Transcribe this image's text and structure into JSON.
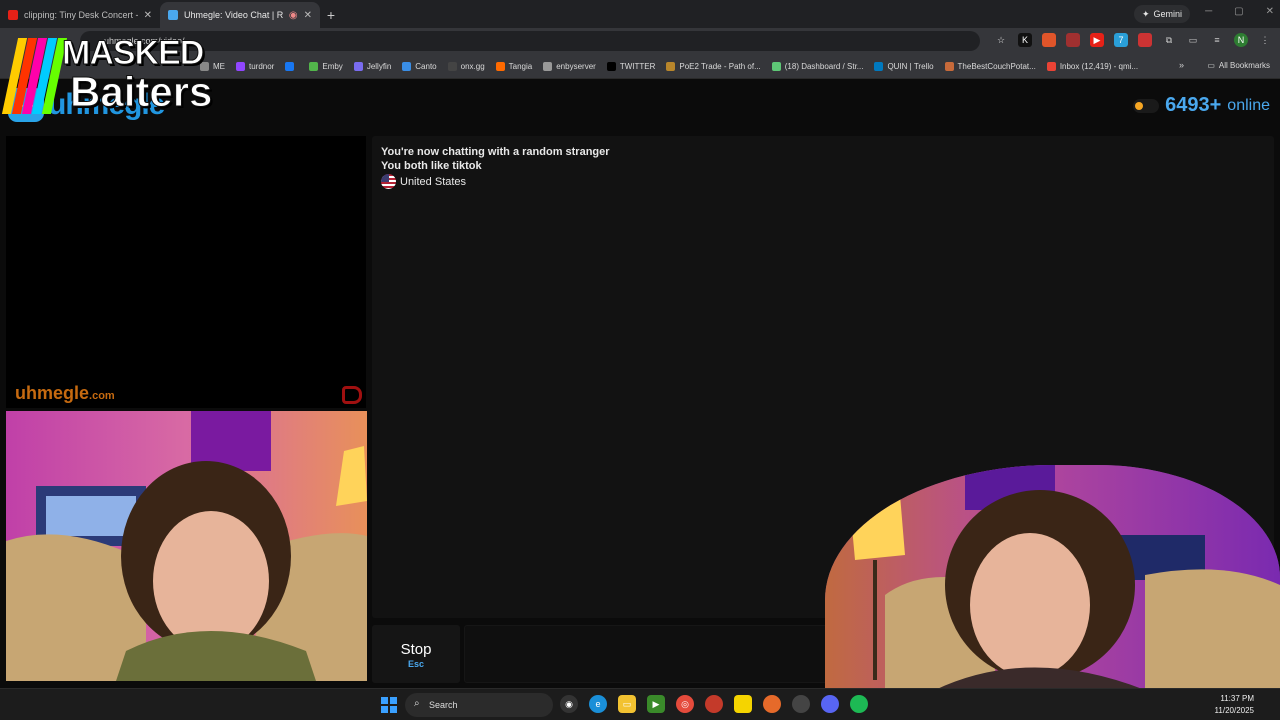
{
  "browser": {
    "tabs": [
      {
        "title": "clipping: Tiny Desk Concert - Y",
        "color": "#e62117"
      },
      {
        "title": "Uhmegle: Video Chat | Rand",
        "color": "#4aa8ee"
      }
    ],
    "gemini_label": "Gemini",
    "url": "uhmegle.com/video/",
    "bookmarks": [
      {
        "label": "ME",
        "color": "#888888"
      },
      {
        "label": "turdnor",
        "color": "#9146ff"
      },
      {
        "label": "",
        "color": "#1877f2"
      },
      {
        "label": "Emby",
        "color": "#52b54b"
      },
      {
        "label": "Jellyfin",
        "color": "#7a6cf0"
      },
      {
        "label": "Canto",
        "color": "#3a8ee6"
      },
      {
        "label": "onx.gg",
        "color": "#444444"
      },
      {
        "label": "Tangia",
        "color": "#ff6a00"
      },
      {
        "label": "enbyserver",
        "color": "#999999"
      },
      {
        "label": "TWITTER",
        "color": "#000000"
      },
      {
        "label": "PoE2 Trade - Path of...",
        "color": "#b8862b"
      },
      {
        "label": "(18) Dashboard / Str...",
        "color": "#5ec776"
      },
      {
        "label": "QUIN | Trello",
        "color": "#0079bf"
      },
      {
        "label": "TheBestCouchPotat...",
        "color": "#c76a3a"
      },
      {
        "label": "Inbox (12,419) - qmi...",
        "color": "#ea4335"
      }
    ],
    "all_bookmarks": "All Bookmarks"
  },
  "overlay_logo": {
    "line1": "MASKED",
    "line2": "Baiters"
  },
  "site": {
    "logo_text": "uhmegle",
    "online_count": "6493+",
    "online_label": "online",
    "watermark_main": "uhmegle",
    "watermark_suffix": ".com"
  },
  "chat": {
    "messages": [
      "You're now chatting with a random stranger",
      "You both like tiktok"
    ],
    "country": "United States"
  },
  "controls": {
    "stop_label": "Stop",
    "stop_key": "Esc"
  },
  "taskbar": {
    "search_label": "Search",
    "time": "11:37 PM",
    "date": "11/20/2025"
  }
}
